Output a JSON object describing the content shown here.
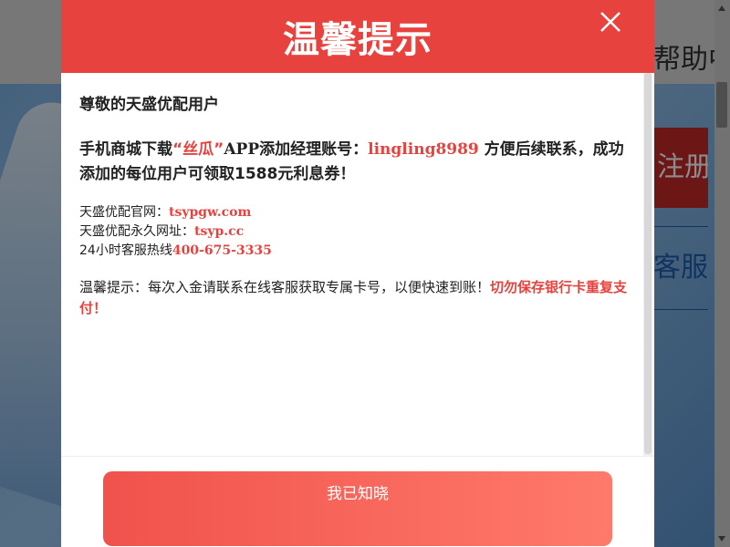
{
  "background": {
    "help_text": "帮助中",
    "register_text": "注册",
    "service_text": "客服"
  },
  "modal": {
    "title": "温馨提示",
    "greeting": "尊敬的天盛优配用户",
    "main": {
      "part1": "手机商城下载",
      "app_name": "“丝瓜”",
      "part2": "APP添加经理账号：",
      "account": "lingling8989",
      "part3": " 方便后续联系，成功添加的每位用户可领取1588元利息券！"
    },
    "info": [
      {
        "label": "天盛优配官网：",
        "value": "tsypgw.com"
      },
      {
        "label": "天盛优配永久网址：",
        "value": "tsyp.cc"
      },
      {
        "label": "24小时客服热线",
        "value": "400-675-3335"
      }
    ],
    "tip": {
      "text": "温馨提示：每次入金请联系在线客服获取专属卡号，以便快速到账！",
      "warning": "切勿保存银行卡重复支付！"
    },
    "ok_button": "我已知晓"
  },
  "colors": {
    "accent": "#e8423f",
    "button_start": "#f0524c",
    "button_end": "#ff7a6b"
  }
}
